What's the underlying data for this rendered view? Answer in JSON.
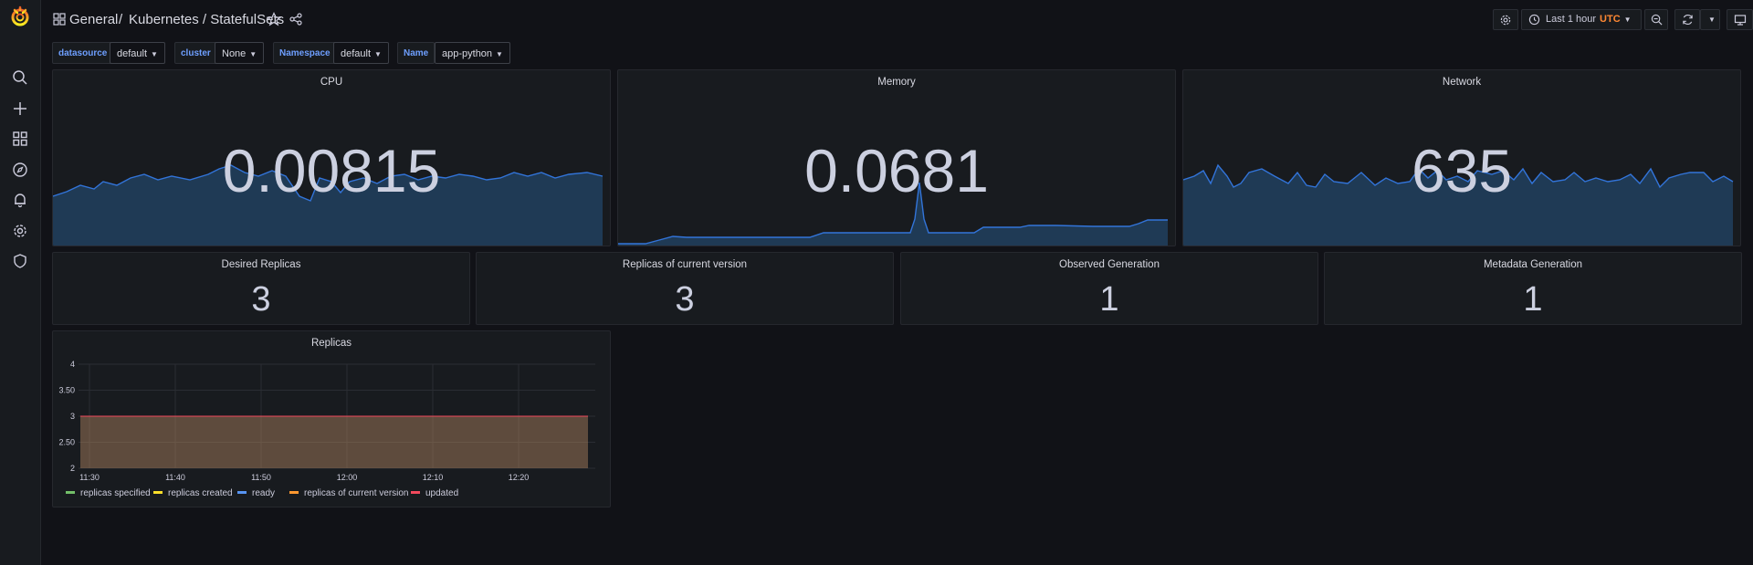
{
  "breadcrumb": {
    "part1": "General",
    "part2": "Kubernetes / StatefulSets"
  },
  "toolbar": {
    "time_range": "Last 1 hour",
    "timezone": "UTC"
  },
  "variables": [
    {
      "label": "datasource",
      "value": "default"
    },
    {
      "label": "cluster",
      "value": "None"
    },
    {
      "label": "Namespace",
      "value": "default"
    },
    {
      "label": "Name",
      "value": "app-python"
    }
  ],
  "stats": {
    "cpu": {
      "title": "CPU",
      "value": "0.00815"
    },
    "memory": {
      "title": "Memory",
      "value": "0.0681"
    },
    "network": {
      "title": "Network",
      "value": "635"
    }
  },
  "small_stats": [
    {
      "title": "Desired Replicas",
      "value": "3"
    },
    {
      "title": "Replicas of current version",
      "value": "3"
    },
    {
      "title": "Observed Generation",
      "value": "1"
    },
    {
      "title": "Metadata Generation",
      "value": "1"
    }
  ],
  "replicas_panel": {
    "title": "Replicas"
  },
  "colors": {
    "accent_orange": "#ff8833",
    "variable_label": "#6e9fff",
    "sparkline_line": "#3274d9",
    "sparkline_fill": "#1f3a55",
    "replica_fill": "#6b553a",
    "replica_line": "#f2495c"
  },
  "chart_data": [
    {
      "type": "area",
      "title": "Replicas",
      "x": [
        "11:30",
        "11:40",
        "11:50",
        "12:00",
        "12:10",
        "12:20"
      ],
      "ylim": [
        2,
        4
      ],
      "yticks": [
        "2",
        "2.50",
        "3",
        "3.50",
        "4"
      ],
      "grid": true,
      "legend_placement": "bottom-left",
      "series": [
        {
          "name": "replicas specified",
          "color": "#73bf69",
          "value": 3
        },
        {
          "name": "replicas created",
          "color": "#fade2a",
          "value": 3
        },
        {
          "name": "ready",
          "color": "#5794f2",
          "value": 3
        },
        {
          "name": "replicas of current version",
          "color": "#ff9830",
          "value": 3
        },
        {
          "name": "updated",
          "color": "#f2495c",
          "value": 3
        }
      ]
    }
  ]
}
